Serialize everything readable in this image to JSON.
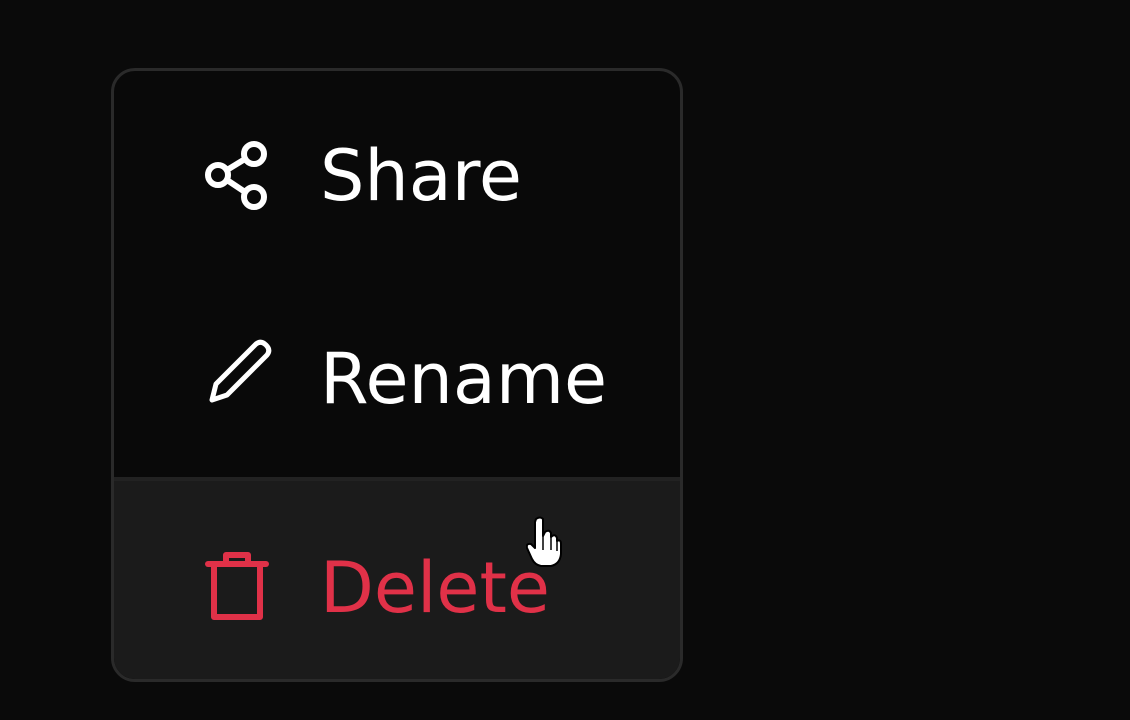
{
  "context_menu": {
    "items": [
      {
        "label": "Share",
        "icon": "share-icon",
        "color": "#ffffff"
      },
      {
        "label": "Rename",
        "icon": "pencil-icon",
        "color": "#ffffff"
      },
      {
        "label": "Delete",
        "icon": "trash-icon",
        "color": "#e03148",
        "state": "hovered"
      }
    ]
  },
  "cursor": {
    "icon": "hand-pointer-icon"
  }
}
